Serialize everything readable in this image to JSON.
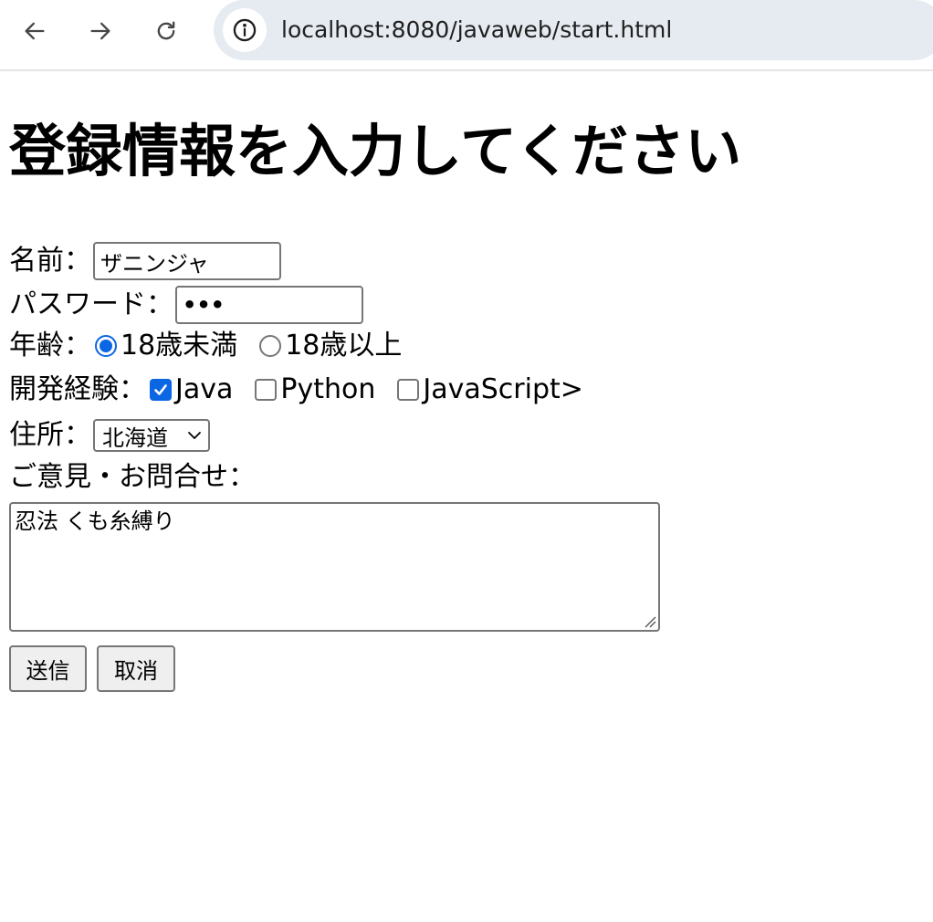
{
  "browser": {
    "url": "localhost:8080/javaweb/start.html",
    "icons": {
      "back": "arrow-left-icon",
      "forward": "arrow-right-icon",
      "reload": "reload-icon",
      "site_info": "info-circle-icon"
    }
  },
  "page": {
    "title": "登録情報を入力してください"
  },
  "form": {
    "name": {
      "label": "名前：",
      "value": "ザニンジャ"
    },
    "password": {
      "label": "パスワード：",
      "value": "•••"
    },
    "age": {
      "label": "年齢：",
      "options": [
        {
          "label": "18歳未満",
          "checked": true
        },
        {
          "label": "18歳以上",
          "checked": false
        }
      ]
    },
    "dev_experience": {
      "label": "開発経験：",
      "options": [
        {
          "label": "Java",
          "checked": true
        },
        {
          "label": "Python",
          "checked": false
        },
        {
          "label": "JavaScript>",
          "checked": false
        }
      ]
    },
    "address": {
      "label": "住所：",
      "selected": "北海道"
    },
    "comment": {
      "label": "ご意見・お問合せ：",
      "value": "忍法 くも糸縛り"
    },
    "submit_label": "送信",
    "cancel_label": "取消"
  },
  "colors": {
    "accent": "#0b66e4",
    "omnibox_bg": "#e6eaf1",
    "border": "#767676",
    "button_bg": "#efefef"
  }
}
